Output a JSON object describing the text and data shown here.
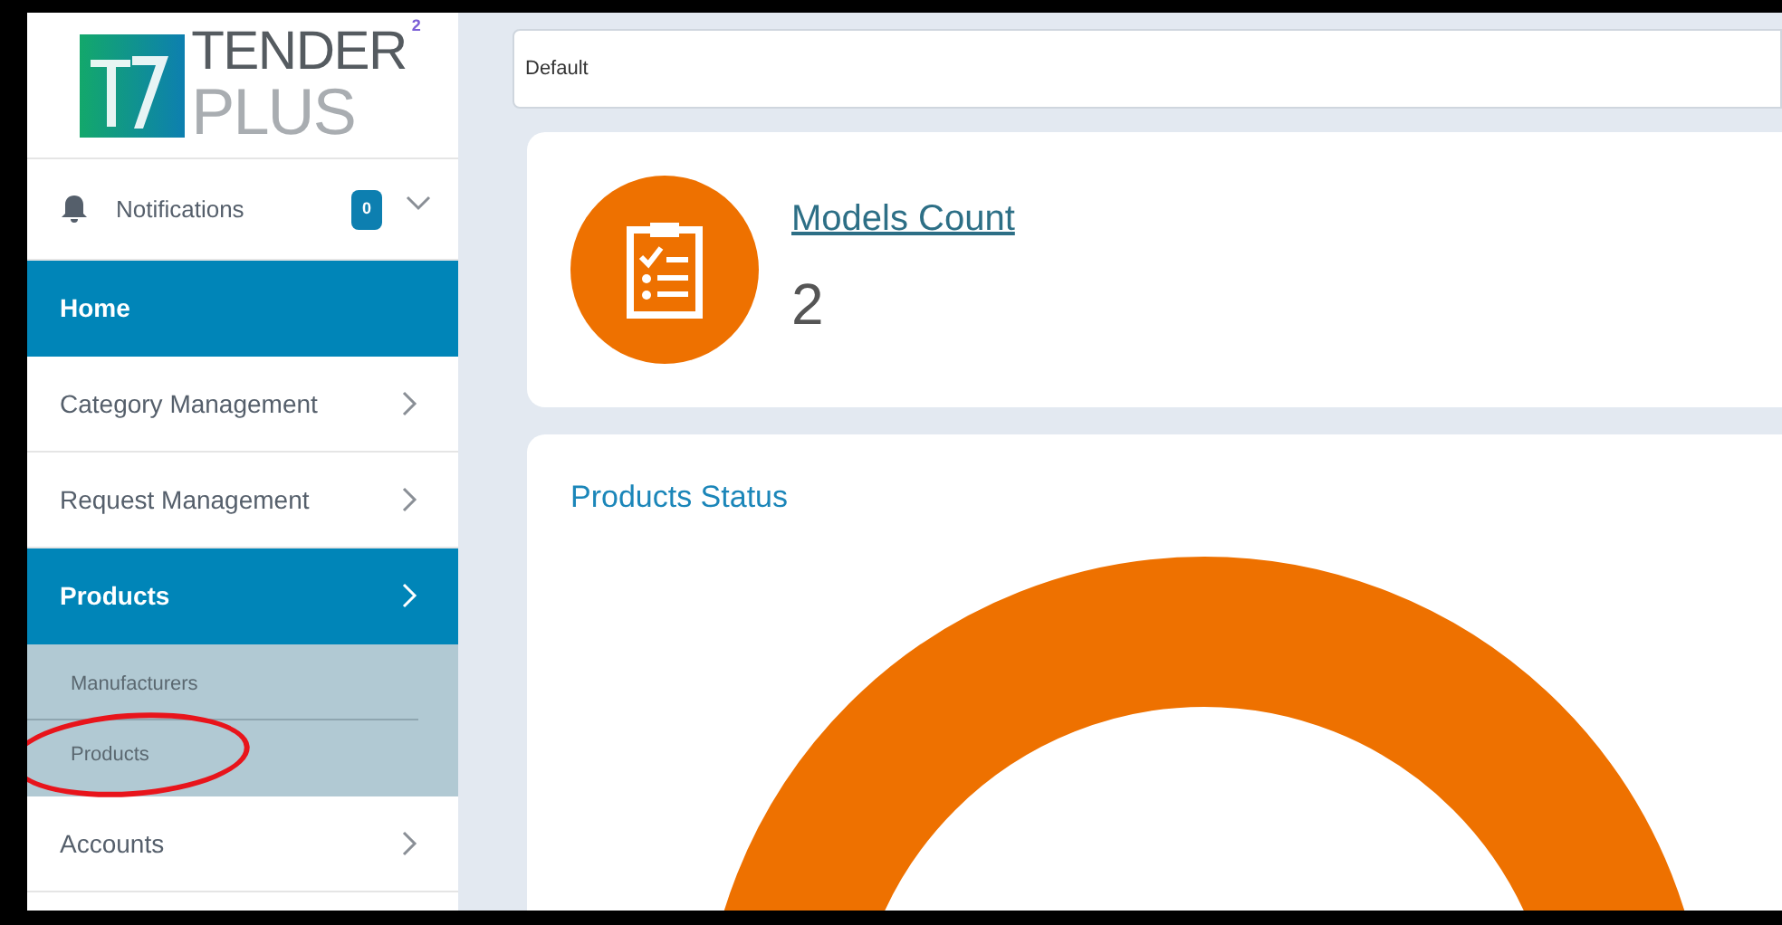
{
  "logo": {
    "word_1": "TENDER",
    "word_2": "PLUS",
    "superscript": "2"
  },
  "notifications": {
    "label": "Notifications",
    "count": "0",
    "expanded": false
  },
  "sidebar": {
    "items": [
      {
        "label": "Home",
        "kind": "link",
        "selected": true
      },
      {
        "label": "Category Management",
        "kind": "group",
        "selected": false
      },
      {
        "label": "Request Management",
        "kind": "group",
        "selected": false
      },
      {
        "label": "Products",
        "kind": "group",
        "selected": true,
        "children": [
          {
            "label": "Manufacturers",
            "highlighted": false
          },
          {
            "label": "Products",
            "highlighted": true
          }
        ]
      },
      {
        "label": "Accounts",
        "kind": "group",
        "selected": false
      }
    ]
  },
  "filter": {
    "value": "Default"
  },
  "models_card": {
    "title": "Models Count",
    "value": "2"
  },
  "status_card": {
    "title": "Products Status"
  }
}
